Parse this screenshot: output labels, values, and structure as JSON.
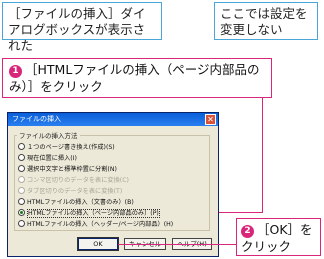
{
  "notes": {
    "left": "［ファイルの挿入］ダイアログボックスが表示された",
    "right": "ここでは設定を変更しない"
  },
  "callout1": {
    "number": "1",
    "text": "［HTMLファイルの挿入（ページ内部品のみ）］をクリック"
  },
  "callout2": {
    "number": "2",
    "text": "［OK］をクリック"
  },
  "dialog": {
    "title": "ファイルの挿入",
    "close_glyph": "✕",
    "group_label": "ファイルの挿入方法",
    "options": [
      {
        "label": "１つのページ書き換え(作成)(S)",
        "disabled": false,
        "selected": false
      },
      {
        "label": "現在位置に挿入(I)",
        "disabled": false,
        "selected": false
      },
      {
        "label": "選択中文字と標準枠置に分割(N)",
        "disabled": false,
        "selected": false
      },
      {
        "label": "コンマ区切りのデータを表に変換(C)",
        "disabled": true,
        "selected": false
      },
      {
        "label": "タブ区切りのデータを表に変換(T)",
        "disabled": true,
        "selected": false
      },
      {
        "label": "HTMLファイルの挿入（文書のみ）(B)",
        "disabled": false,
        "selected": false
      },
      {
        "label": "HTMLファイルの挿入（ページ内部品のみ）(P)",
        "disabled": false,
        "selected": true
      },
      {
        "label": "HTMLファイルの挿入（ヘッダー/ページ内部品）(H)",
        "disabled": false,
        "selected": false
      }
    ],
    "buttons": {
      "ok": "OK",
      "cancel": "キャンセル",
      "help": "ヘルプ(H)"
    }
  }
}
